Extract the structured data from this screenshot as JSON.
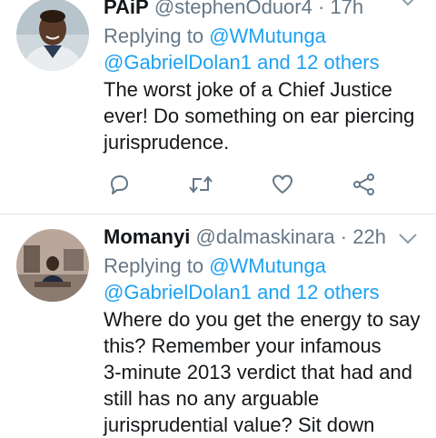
{
  "tweets": [
    {
      "name": "PAiP",
      "handle": "@stephenOduor4",
      "separator": "·",
      "time": "17h",
      "replying_to_label": "Replying to",
      "reply_handle": "@WMutunga",
      "reply_others": "@GabrielDolan1 and 12 others",
      "body_lines": [
        "The worst joke of a Chief Justice",
        "ever! Do something on ear piercing",
        "jurisprudence."
      ]
    },
    {
      "name": "Momanyi",
      "handle": "@dalmaskinara",
      "separator": "·",
      "time": "22h",
      "replying_to_label": "Replying to",
      "reply_handle": "@WMutunga",
      "reply_others": "@GabrielDolan1 and 12 others",
      "body_lines": [
        "Where do you get the energy to say",
        "this? Remember your infamous",
        "3-minute 2013 verdict that had and",
        "still has no any arguable",
        "jurisprudential value? Sit down"
      ]
    }
  ],
  "icons": {
    "reply": "reply-icon",
    "retweet": "retweet-icon",
    "like": "heart-icon",
    "share": "share-icon",
    "more": "chevron-down-icon"
  },
  "colors": {
    "link": "#1da1f2",
    "secondary_text": "#657786",
    "divider": "#e1e8ed",
    "icon": "#657786"
  }
}
